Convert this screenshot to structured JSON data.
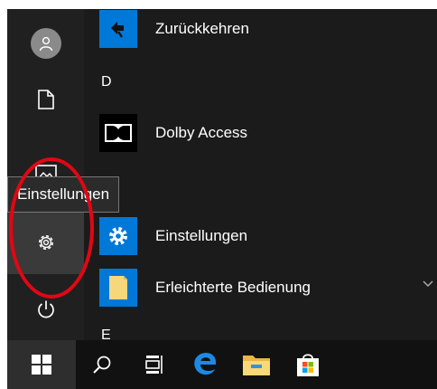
{
  "tooltip": {
    "text": "Einstellungen"
  },
  "rail": {
    "items": [
      {
        "name": "user-account",
        "icon": "user-icon"
      },
      {
        "name": "documents",
        "icon": "document-icon"
      },
      {
        "name": "pictures",
        "icon": "pictures-icon"
      },
      {
        "name": "settings",
        "icon": "gear-icon"
      },
      {
        "name": "power",
        "icon": "power-icon"
      }
    ]
  },
  "app_list": {
    "apps": [
      {
        "label": "Zurückkehren",
        "icon": "back-arrow-icon",
        "tile_color": "#0078d7"
      },
      {
        "label": "Dolby Access",
        "icon": "dolby-logo-icon",
        "tile_color": "#000000"
      },
      {
        "label": "Einstellungen",
        "icon": "gear-icon",
        "tile_color": "#0078d7"
      },
      {
        "label": "Erleichterte Bedienung",
        "icon": "folder-icon",
        "tile_color": "#0078d7"
      }
    ],
    "letters": [
      "D",
      "E"
    ]
  },
  "taskbar": {
    "items": [
      {
        "name": "start",
        "icon": "windows-logo-icon"
      },
      {
        "name": "search",
        "icon": "search-icon"
      },
      {
        "name": "task-view",
        "icon": "task-view-icon"
      },
      {
        "name": "edge",
        "icon": "edge-icon"
      },
      {
        "name": "file-explorer",
        "icon": "folder-icon"
      },
      {
        "name": "store",
        "icon": "store-icon"
      }
    ]
  },
  "colors": {
    "accent": "#0078d7",
    "annotation": "#e30613",
    "menu_bg": "#1b1b1b",
    "taskbar_bg": "#111111"
  }
}
